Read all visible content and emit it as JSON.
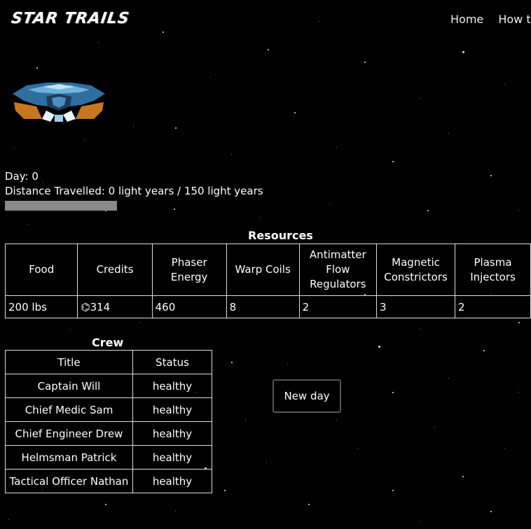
{
  "brand": {
    "logo": "STAR TRAILS"
  },
  "nav": {
    "items": [
      "Home",
      "How t"
    ]
  },
  "status": {
    "day": "Day: 0",
    "distance": "Distance Travelled: 0 light years / 150 light years",
    "progress": 0
  },
  "resources": {
    "caption": "Resources",
    "headers": [
      "Food",
      "Credits",
      "Phaser Energy",
      "Warp Coils",
      "Antimatter Flow Regulators",
      "Magnetic Constrictors",
      "Plasma Injectors"
    ],
    "values": [
      "200 lbs",
      "⌬314",
      "460",
      "8",
      "2",
      "3",
      "2"
    ]
  },
  "crew": {
    "caption": "Crew",
    "headers": [
      "Title",
      "Status"
    ],
    "rows": [
      [
        "Captain Will",
        "healthy"
      ],
      [
        "Chief Medic Sam",
        "healthy"
      ],
      [
        "Chief Engineer Drew",
        "healthy"
      ],
      [
        "Helmsman Patrick",
        "healthy"
      ],
      [
        "Tactical Officer Nathan",
        "healthy"
      ]
    ]
  },
  "actions": {
    "new_day": "New day"
  }
}
